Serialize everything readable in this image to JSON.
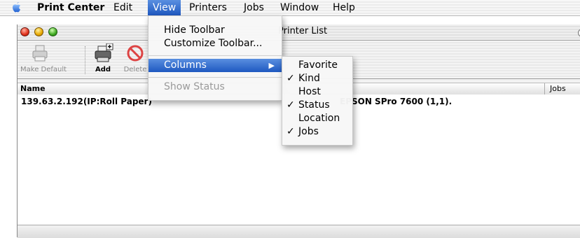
{
  "menubar": {
    "items": [
      "Print Center",
      "Edit",
      "View",
      "Printers",
      "Jobs",
      "Window",
      "Help"
    ]
  },
  "window": {
    "title": "Printer List",
    "toolbar": {
      "make_default": "Make Default",
      "add": "Add",
      "delete": "Delete"
    },
    "columns": {
      "name": "Name",
      "jobs": "Jobs"
    },
    "rows": [
      {
        "name": "139.63.2.192(IP:Roll Paper)",
        "kind": "EPSON SPro 7600 (1,1)."
      }
    ]
  },
  "view_menu": {
    "items": [
      "Hide Toolbar",
      "Customize Toolbar...",
      "Columns",
      "Show Status"
    ]
  },
  "columns_submenu": {
    "items": [
      {
        "label": "Favorite",
        "checked": false
      },
      {
        "label": "Kind",
        "checked": true
      },
      {
        "label": "Host",
        "checked": false
      },
      {
        "label": "Status",
        "checked": true
      },
      {
        "label": "Location",
        "checked": false
      },
      {
        "label": "Jobs",
        "checked": true
      }
    ],
    "check_glyph": "✓"
  },
  "colors": {
    "highlight": "#2f67c7"
  }
}
